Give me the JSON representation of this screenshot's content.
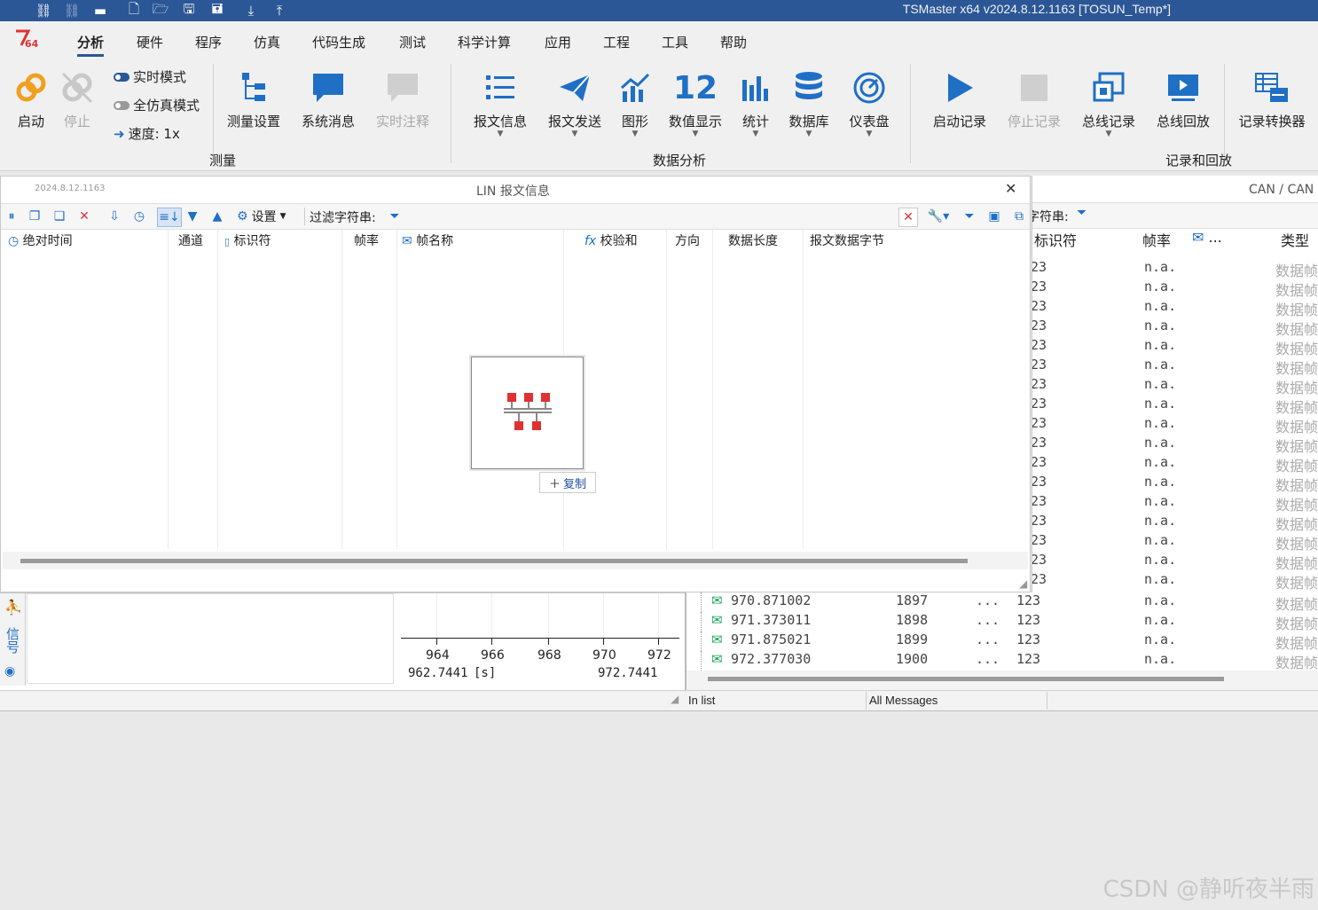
{
  "titlebar": {
    "title": "TSMaster x64 v2024.8.12.1163 [TOSUN_Temp*]",
    "quick_access": [
      "link-icon",
      "unlink-icon",
      "chat-icon",
      "new-file-icon",
      "open-folder-icon",
      "save-icon",
      "save-all-icon",
      "download-icon",
      "upload-icon"
    ]
  },
  "menu": {
    "logo": "64",
    "items": [
      "分析",
      "硬件",
      "程序",
      "仿真",
      "代码生成",
      "测试",
      "科学计算",
      "应用",
      "工程",
      "工具",
      "帮助"
    ]
  },
  "ribbon": {
    "start": "启动",
    "stop": "停止",
    "realtime_mode": "实时模式",
    "full_sim_mode": "全仿真模式",
    "speed": "速度: 1x",
    "measure_setup": "测量设置",
    "system_msg": "系统消息",
    "realtime_note": "实时注释",
    "group_measure": "测量",
    "msg_info": "报文信息",
    "msg_send": "报文发送",
    "graphics": "图形",
    "numeric_display": "数值显示",
    "numeric_number": "12",
    "statistics": "统计",
    "database": "数据库",
    "dashboard": "仪表盘",
    "group_analysis": "数据分析",
    "start_record": "启动记录",
    "stop_record": "停止记录",
    "bus_record": "总线记录",
    "bus_replay": "总线回放",
    "record_converter": "记录转换器",
    "group_record": "记录和回放"
  },
  "lin_panel": {
    "version": "2024.8.12.1163",
    "title": "LIN 报文信息",
    "settings": "设置",
    "filter_label": "过滤字符串:",
    "columns": [
      "绝对时间",
      "通道",
      "标识符",
      "帧率",
      "帧名称",
      "校验和",
      "方向",
      "数据长度",
      "报文数据字节"
    ],
    "copy_label": "复制"
  },
  "can_panel": {
    "title": "CAN / CAN",
    "filter_label": "字符串:",
    "columns": [
      "标识符",
      "帧率",
      "...",
      "类型"
    ],
    "row_id": "23",
    "row_rate": "n.a.",
    "row_type": "数据帧",
    "rows": [
      {
        "time": "970.871002",
        "count": "1897",
        "dots": "...",
        "id": "123",
        "rate": "n.a.",
        "type": "数据帧"
      },
      {
        "time": "971.373011",
        "count": "1898",
        "dots": "...",
        "id": "123",
        "rate": "n.a.",
        "type": "数据帧"
      },
      {
        "time": "971.875021",
        "count": "1899",
        "dots": "...",
        "id": "123",
        "rate": "n.a.",
        "type": "数据帧"
      },
      {
        "time": "972.377030",
        "count": "1900",
        "dots": "...",
        "id": "123",
        "rate": "n.a.",
        "type": "数据帧"
      }
    ]
  },
  "bottom": {
    "signal_tab": "信号",
    "axis_ticks": [
      "964",
      "966",
      "968",
      "970",
      "972"
    ],
    "axis_start": "962.7441",
    "axis_unit": "[s]",
    "axis_end": "972.7441",
    "status_in_list": "In list",
    "status_all_messages": "All Messages"
  },
  "watermark": "CSDN @静听夜半雨",
  "colors": {
    "accent": "#2b5797",
    "icon_blue": "#1f6fc5",
    "disabled": "#a8a8a8"
  }
}
